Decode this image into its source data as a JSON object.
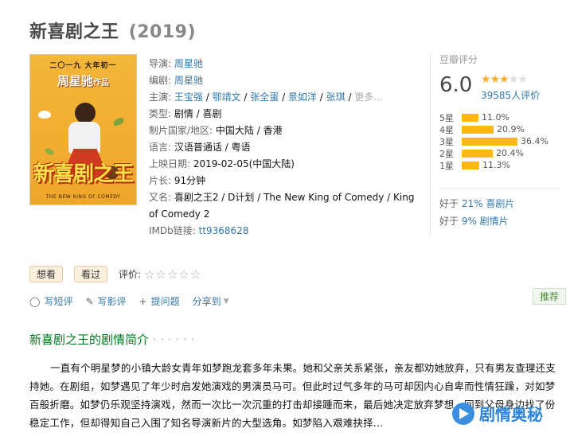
{
  "movie": {
    "title": "新喜剧之王",
    "year": "(2019)"
  },
  "poster": {
    "top_line": "二〇一九  大年初一",
    "director_credit": "周星驰",
    "director_suffix": "作品",
    "big_title": "新喜剧之王",
    "sub_title": "THE NEW KING OF COMEDY"
  },
  "info": {
    "director_label": "导演: ",
    "director": "周星驰",
    "writer_label": "编剧: ",
    "writer": "周星驰",
    "cast_label": "主演: ",
    "cast": [
      "王宝强",
      "鄂靖文",
      "张全蛋",
      "景如洋",
      "张琪"
    ],
    "cast_more": "更多...",
    "genre_label": "类型: ",
    "genre": "剧情 / 喜剧",
    "country_label": "制片国家/地区: ",
    "country": "中国大陆 / 香港",
    "language_label": "语言: ",
    "language": "汉语普通话 / 粤语",
    "release_label": "上映日期: ",
    "release": "2019-02-05(中国大陆)",
    "runtime_label": "片长: ",
    "runtime": "91分钟",
    "aka_label": "又名: ",
    "aka": "喜剧之王2 / D计划 / The New King of Comedy / King of Comedy 2",
    "imdb_label": "IMDb链接: ",
    "imdb": "tt9368628"
  },
  "rating": {
    "title": "豆瓣评分",
    "score": "6.0",
    "stars_filled": 3,
    "stars_total": 5,
    "votes": "39585人评价",
    "distribution": [
      {
        "label": "5星",
        "percent_text": "11.0%",
        "percent": 11.0
      },
      {
        "label": "4星",
        "percent_text": "20.9%",
        "percent": 20.9
      },
      {
        "label": "3星",
        "percent_text": "36.4%",
        "percent": 36.4
      },
      {
        "label": "2星",
        "percent_text": "20.4%",
        "percent": 20.4
      },
      {
        "label": "1星",
        "percent_text": "11.3%",
        "percent": 11.3
      }
    ],
    "better_than": [
      {
        "prefix": "好于 ",
        "value": "21% 喜剧片"
      },
      {
        "prefix": "好于 ",
        "value": "9% 剧情片"
      }
    ]
  },
  "actions": {
    "want_label": "想看",
    "seen_label": "看过",
    "rate_label": "评价:",
    "rate_stars": "☆☆☆☆☆"
  },
  "tools": {
    "short_review": "写短评",
    "review": "写影评",
    "question": "提问题",
    "share": "分享到"
  },
  "recommend_label": "推荐",
  "summary": {
    "title": "新喜剧之王的剧情简介",
    "dots": " · · · · · ·",
    "text": "一直有个明星梦的小镇大龄女青年如梦跑龙套多年未果。她和父亲关系紧张，亲友都劝她放弃，只有男友查理还支持她。在剧组，如梦遇见了年少时启发她演戏的男演员马可。但此时过气多年的马可却因内心自卑而性情狂躁，对如梦百般折磨。如梦仍乐观坚持演戏，然而一次比一次沉重的打击却接踵而来，最后她决定放弃梦想，回到父母身边找了份稳定工作，但却得知自己入围了知名导演新片的大型选角。如梦陷入艰难抉择..."
  },
  "watermark": {
    "text": "剧情奥秘"
  },
  "colors": {
    "link": "#3377aa",
    "star": "#ffac2d",
    "bar": "#ffb712",
    "section_title": "#007722"
  }
}
